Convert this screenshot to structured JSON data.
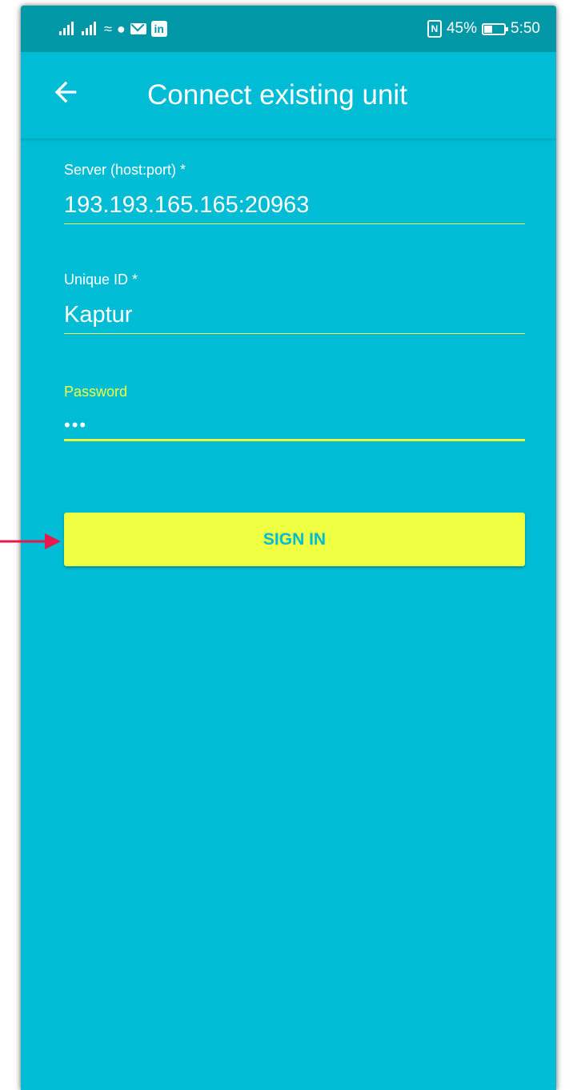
{
  "statusbar": {
    "nfc_label": "N",
    "battery_text": "45%",
    "battery_percent": 45,
    "time": "5:50",
    "linkedin_label": "in",
    "icons": [
      "signal-icon",
      "signal-icon",
      "wifi-icon",
      "notification-icon",
      "mail-icon",
      "linkedin-icon",
      "nfc-icon",
      "battery-icon"
    ]
  },
  "appbar": {
    "title": "Connect existing unit"
  },
  "form": {
    "server": {
      "label": "Server (host:port) *",
      "value": "193.193.165.165:20963"
    },
    "unique_id": {
      "label": "Unique ID *",
      "value": "Kaptur"
    },
    "password": {
      "label": "Password",
      "value": "•••"
    },
    "sign_in_label": "SIGN IN"
  },
  "colors": {
    "primary": "#00bcd4",
    "primary_dark": "#0097a7",
    "accent": "#eeff41",
    "annotation_arrow": "#e8174c"
  }
}
